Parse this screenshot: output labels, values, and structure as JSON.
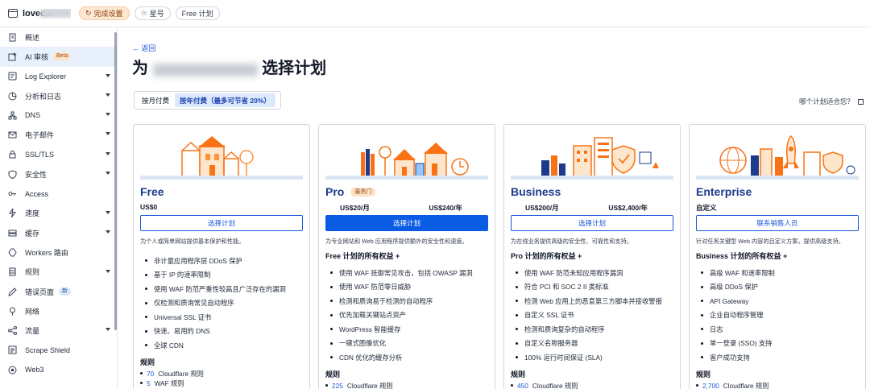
{
  "topbar": {
    "site_name": "lovecx",
    "setup_label": "完成设置",
    "star_label": "星号",
    "plan_label": "Free 计划"
  },
  "sidebar": {
    "items": [
      {
        "label": "概述",
        "icon": "document-icon",
        "caret": false,
        "badge": ""
      },
      {
        "label": "AI 审核",
        "icon": "ai-audit-icon",
        "caret": false,
        "badge": "Beta",
        "active": true
      },
      {
        "label": "Log Explorer",
        "icon": "log-explorer-icon",
        "caret": true,
        "badge": ""
      },
      {
        "label": "分析和日志",
        "icon": "analytics-icon",
        "caret": true,
        "badge": ""
      },
      {
        "label": "DNS",
        "icon": "dns-icon",
        "caret": true,
        "badge": ""
      },
      {
        "label": "电子邮件",
        "icon": "email-icon",
        "caret": true,
        "badge": ""
      },
      {
        "label": "SSL/TLS",
        "icon": "lock-icon",
        "caret": true,
        "badge": ""
      },
      {
        "label": "安全性",
        "icon": "shield-icon",
        "caret": true,
        "badge": ""
      },
      {
        "label": "Access",
        "icon": "access-icon",
        "caret": false,
        "badge": ""
      },
      {
        "label": "速度",
        "icon": "speed-icon",
        "caret": true,
        "badge": ""
      },
      {
        "label": "缓存",
        "icon": "cache-icon",
        "caret": true,
        "badge": ""
      },
      {
        "label": "Workers 路由",
        "icon": "workers-icon",
        "caret": false,
        "badge": ""
      },
      {
        "label": "规则",
        "icon": "rules-icon",
        "caret": true,
        "badge": ""
      },
      {
        "label": "错误页面",
        "icon": "error-page-icon",
        "caret": false,
        "badge": "新"
      },
      {
        "label": "网络",
        "icon": "network-icon",
        "caret": false,
        "badge": ""
      },
      {
        "label": "流量",
        "icon": "traffic-icon",
        "caret": true,
        "badge": ""
      },
      {
        "label": "Scrape Shield",
        "icon": "scrape-shield-icon",
        "caret": false,
        "badge": ""
      },
      {
        "label": "Web3",
        "icon": "web3-icon",
        "caret": false,
        "badge": ""
      }
    ]
  },
  "main": {
    "back_label": "← 返回",
    "title_prefix": "为",
    "title_suffix": "选择计划",
    "billing": {
      "monthly": "按月付费",
      "annual": "按年付费（最多可节省 20%）"
    },
    "which_plan": "哪个计划适合您？"
  },
  "plans": [
    {
      "name": "Free",
      "badge": "",
      "price_a": "US$0",
      "price_b": "",
      "cta": "选择计划",
      "cta_primary": false,
      "desc": "为个人或简单网站提供基本保护和性能。",
      "benefits_title": "",
      "benefits": [
        "非计量应用程序层 DDoS 保护",
        "基于 IP 的速率限制",
        "使用 WAF 防范严重性较高且广泛存在的漏洞",
        "仅检测和质询常见自动程序",
        "Universal SSL 证书",
        "快速、易用的 DNS",
        "全球 CDN"
      ],
      "rules_title": "规则",
      "rules": [
        {
          "n": "70",
          "t": "Cloudflare 规则"
        },
        {
          "n": "5",
          "t": "WAF 规则"
        }
      ]
    },
    {
      "name": "Pro",
      "badge": "最热门",
      "price_a": "US$20/月",
      "price_b": "US$240/年",
      "cta": "选择计划",
      "cta_primary": true,
      "desc": "为专业网站和 Web 应用程序提供额外的安全性和速度。",
      "benefits_title": "Free 计划的所有权益 +",
      "benefits": [
        "使用 WAF 抵御常见攻击，包括 OWASP 漏洞",
        "使用 WAF 防范零日威胁",
        "检测和质询易于检测的自动程序",
        "优先加载关键站点资产",
        "WordPress 智能缓存",
        "一键式图像优化",
        "CDN 优化的缓存分析"
      ],
      "rules_title": "规则",
      "rules": [
        {
          "n": "225",
          "t": "Cloudflare 规则"
        }
      ]
    },
    {
      "name": "Business",
      "badge": "",
      "price_a": "US$200/月",
      "price_b": "US$2,400/年",
      "cta": "选择计划",
      "cta_primary": false,
      "desc": "为在线业务提供高级的安全性、可靠性和支持。",
      "benefits_title": "Pro 计划的所有权益 +",
      "benefits": [
        "使用 WAF 防范未知应用程序漏洞",
        "符合 PCI 和 SOC 2 II 类标准",
        "检测 Web 应用上的恶意第三方脚本并接收警报",
        "自定义 SSL 证书",
        "检测和质询复杂的自动程序",
        "自定义名称服务器",
        "100% 运行时间保证 (SLA)"
      ],
      "rules_title": "规则",
      "rules": [
        {
          "n": "450",
          "t": "Cloudflare 规则"
        }
      ]
    },
    {
      "name": "Enterprise",
      "badge": "",
      "price_a": "自定义",
      "price_b": "",
      "cta": "联系销售人员",
      "cta_primary": false,
      "desc": "针对任务关键型 Web 内容的自定义方案，提供高级支持。",
      "benefits_title": "Business 计划的所有权益 +",
      "benefits": [
        "高级 WAF 和速率限制",
        "高级 DDoS 保护",
        "API Gateway",
        "企业自动程序管理",
        "日志",
        "单一登录 (SSO) 支持",
        "客户成功支持"
      ],
      "rules_title": "规则",
      "rules": [
        {
          "n": "2,700",
          "t": "Cloudflare 规则"
        }
      ]
    }
  ]
}
